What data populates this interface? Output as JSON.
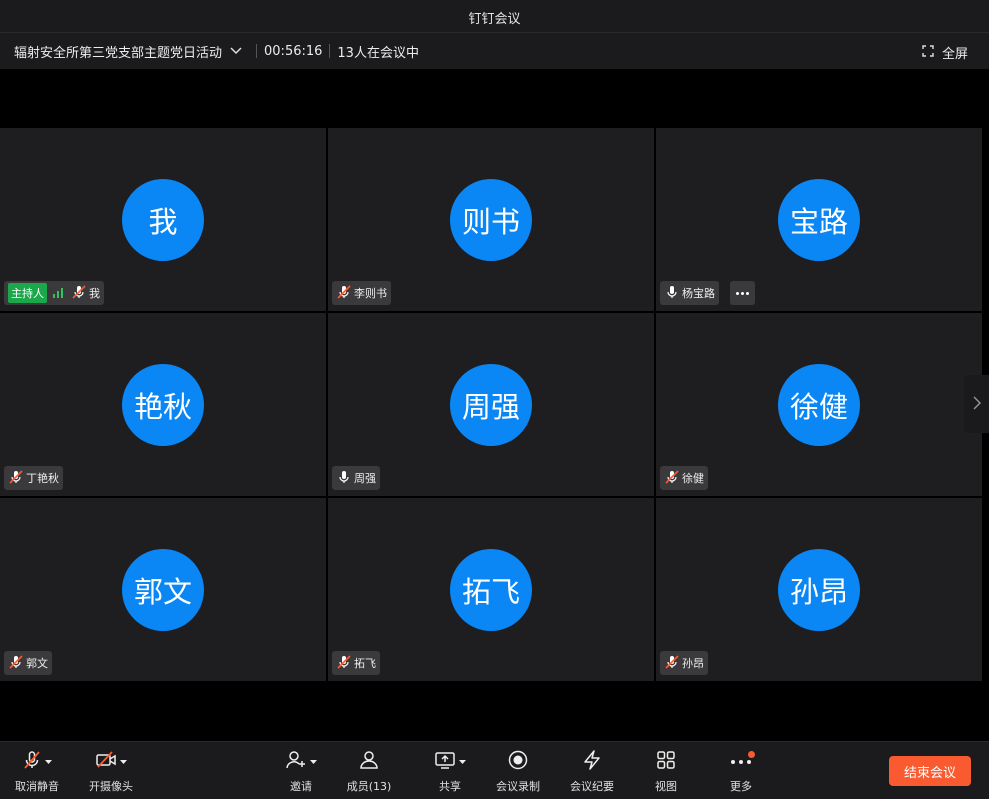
{
  "window": {
    "title": "钉钉会议"
  },
  "meeting": {
    "topic": "辐射安全所第三党支部主题党日活动",
    "timer": "00:56:16",
    "participants_text": "13人在会议中",
    "fullscreen_label": "全屏"
  },
  "host_badge": "主持人",
  "tiles": [
    {
      "avatar": "我",
      "name": "我",
      "mic": "muted",
      "host": true
    },
    {
      "avatar": "则书",
      "name": "李则书",
      "mic": "muted"
    },
    {
      "avatar": "宝路",
      "name": "杨宝路",
      "mic": "active",
      "more_button": true
    },
    {
      "avatar": "艳秋",
      "name": "丁艳秋",
      "mic": "muted"
    },
    {
      "avatar": "周强",
      "name": "周强",
      "mic": "active"
    },
    {
      "avatar": "徐健",
      "name": "徐健",
      "mic": "muted"
    },
    {
      "avatar": "郭文",
      "name": "郭文",
      "mic": "muted"
    },
    {
      "avatar": "拓飞",
      "name": "拓飞",
      "mic": "muted"
    },
    {
      "avatar": "孙昂",
      "name": "孙昂",
      "mic": "muted"
    }
  ],
  "toolbar": {
    "unmute": "取消静音",
    "camera": "开摄像头",
    "invite": "邀请",
    "members": "成员(13)",
    "share": "共享",
    "record": "会议录制",
    "minutes": "会议纪要",
    "view": "视图",
    "more": "更多",
    "end": "结束会议"
  },
  "colors": {
    "avatar": "#0a86f5",
    "host_badge": "#1aa84b",
    "end_button": "#fa5a2f",
    "muted_slash": "#ff5a2d"
  },
  "icons": [
    "mic-muted-icon",
    "mic-icon",
    "camera-off-icon",
    "invite-icon",
    "members-icon",
    "share-screen-icon",
    "record-icon",
    "minutes-icon",
    "view-grid-icon",
    "more-icon",
    "fullscreen-icon",
    "chevron-down-icon",
    "chevron-right-icon"
  ]
}
